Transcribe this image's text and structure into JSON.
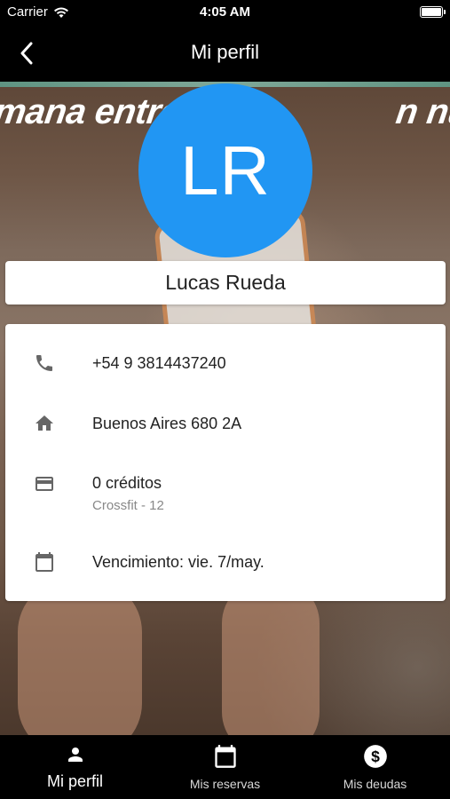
{
  "status_bar": {
    "carrier": "Carrier",
    "time": "4:05 AM"
  },
  "nav": {
    "title": "Mi perfil",
    "back_icon": "chevron-left-icon"
  },
  "hero": {
    "banner_text": "mana entre                       n nuestro B"
  },
  "profile": {
    "initials": "LR",
    "avatar_color": "#2196F3",
    "name": "Lucas Rueda"
  },
  "info": {
    "phone": "+54 9 3814437240",
    "address": "Buenos Aires 680 2A",
    "credits": "0 créditos",
    "plan": "Crossfit - 12",
    "expiration": "Vencimiento: vie. 7/may."
  },
  "tabs": [
    {
      "label": "Mi perfil",
      "icon": "person-icon",
      "active": true
    },
    {
      "label": "Mis reservas",
      "icon": "calendar-icon",
      "active": false
    },
    {
      "label": "Mis deudas",
      "icon": "dollar-circle-icon",
      "active": false
    }
  ]
}
